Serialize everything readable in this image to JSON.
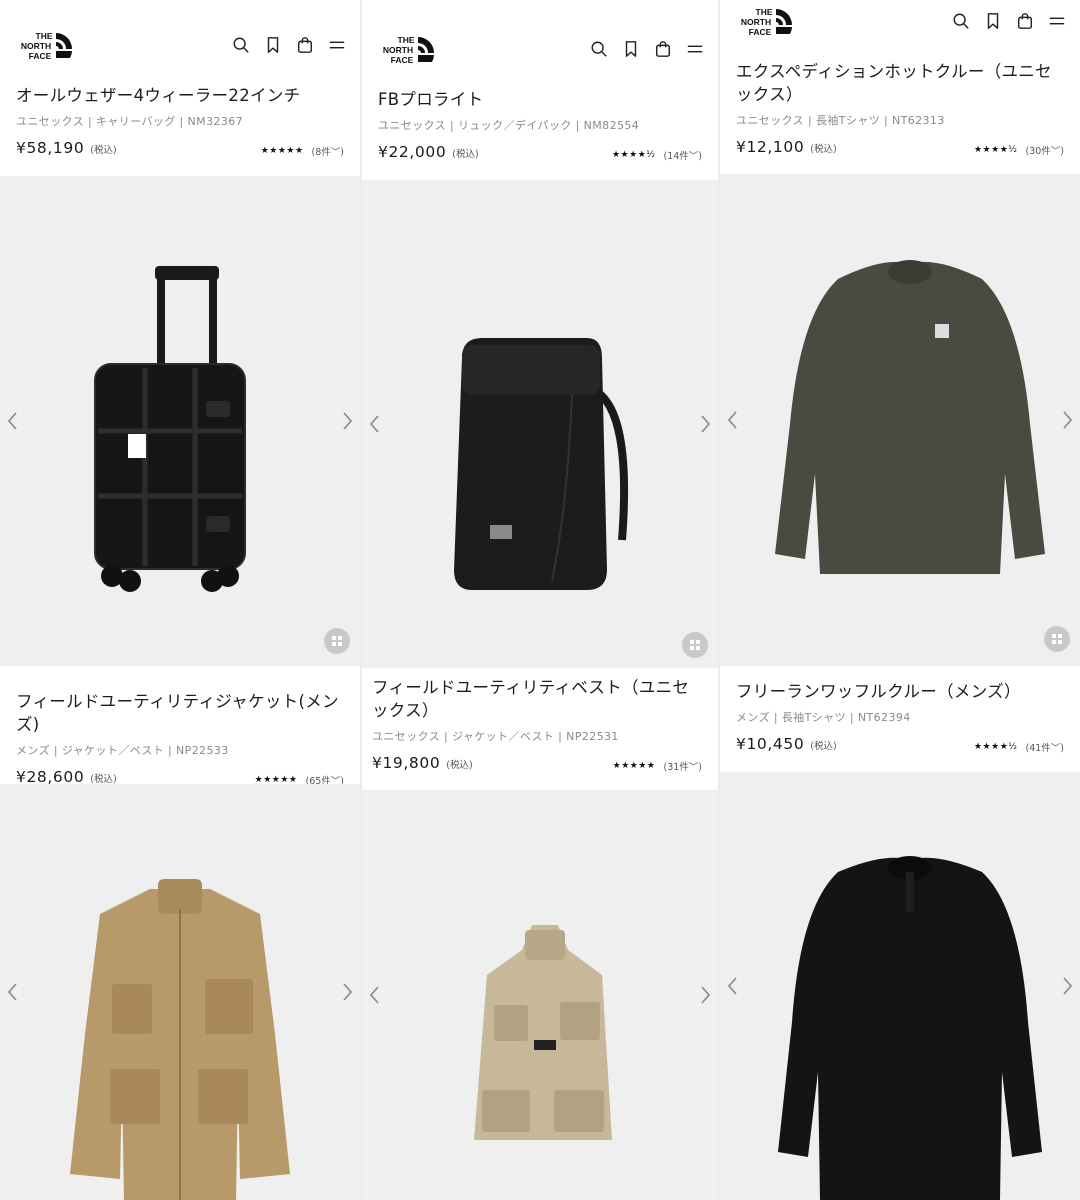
{
  "brand": {
    "logo_line1": "THE",
    "logo_line2": "NORTH",
    "logo_line3": "FACE"
  },
  "products": [
    {
      "name": "オールウェザー4ウィーラー22インチ",
      "category": "ユニセックス | キャリーバッグ | NM32367",
      "price": "¥58,190",
      "tax": "(税込)",
      "stars": "★★★★★",
      "reviews": "(8件﹀)"
    },
    {
      "name": "FBプロライト",
      "category": "ユニセックス | リュック／デイパック | NM82554",
      "price": "¥22,000",
      "tax": "(税込)",
      "stars": "★★★★½",
      "reviews": "(14件﹀)"
    },
    {
      "name": "エクスペディションホットクルー（ユニセックス）",
      "category": "ユニセックス | 長袖Tシャツ | NT62313",
      "price": "¥12,100",
      "tax": "(税込)",
      "stars": "★★★★½",
      "reviews": "(30件﹀)"
    },
    {
      "name": "フィールドユーティリティジャケット(メンズ)",
      "category": "メンズ | ジャケット／ベスト | NP22533",
      "price": "¥28,600",
      "tax": "(税込)",
      "stars": "★★★★★",
      "reviews": "(65件﹀)"
    },
    {
      "name": "フィールドユーティリティベスト（ユニセックス）",
      "category": "ユニセックス | ジャケット／ベスト | NP22531",
      "price": "¥19,800",
      "tax": "(税込)",
      "stars": "★★★★★",
      "reviews": "(31件﹀)"
    },
    {
      "name": "フリーランワッフルクルー（メンズ）",
      "category": "メンズ | 長袖Tシャツ | NT62394",
      "price": "¥10,450",
      "tax": "(税込)",
      "stars": "★★★★½",
      "reviews": "(41件﹀)"
    }
  ],
  "icons": {
    "search": "search-icon",
    "bookmark": "bookmark-icon",
    "cart": "shopping-bag-icon",
    "menu": "hamburger-menu-icon",
    "prev": "chevron-left-icon",
    "next": "chevron-right-icon",
    "grid": "grid-view-icon"
  },
  "colors": {
    "accent": "#222222",
    "image_bg": "#efefef",
    "grid_button": "#c9c9c9"
  }
}
